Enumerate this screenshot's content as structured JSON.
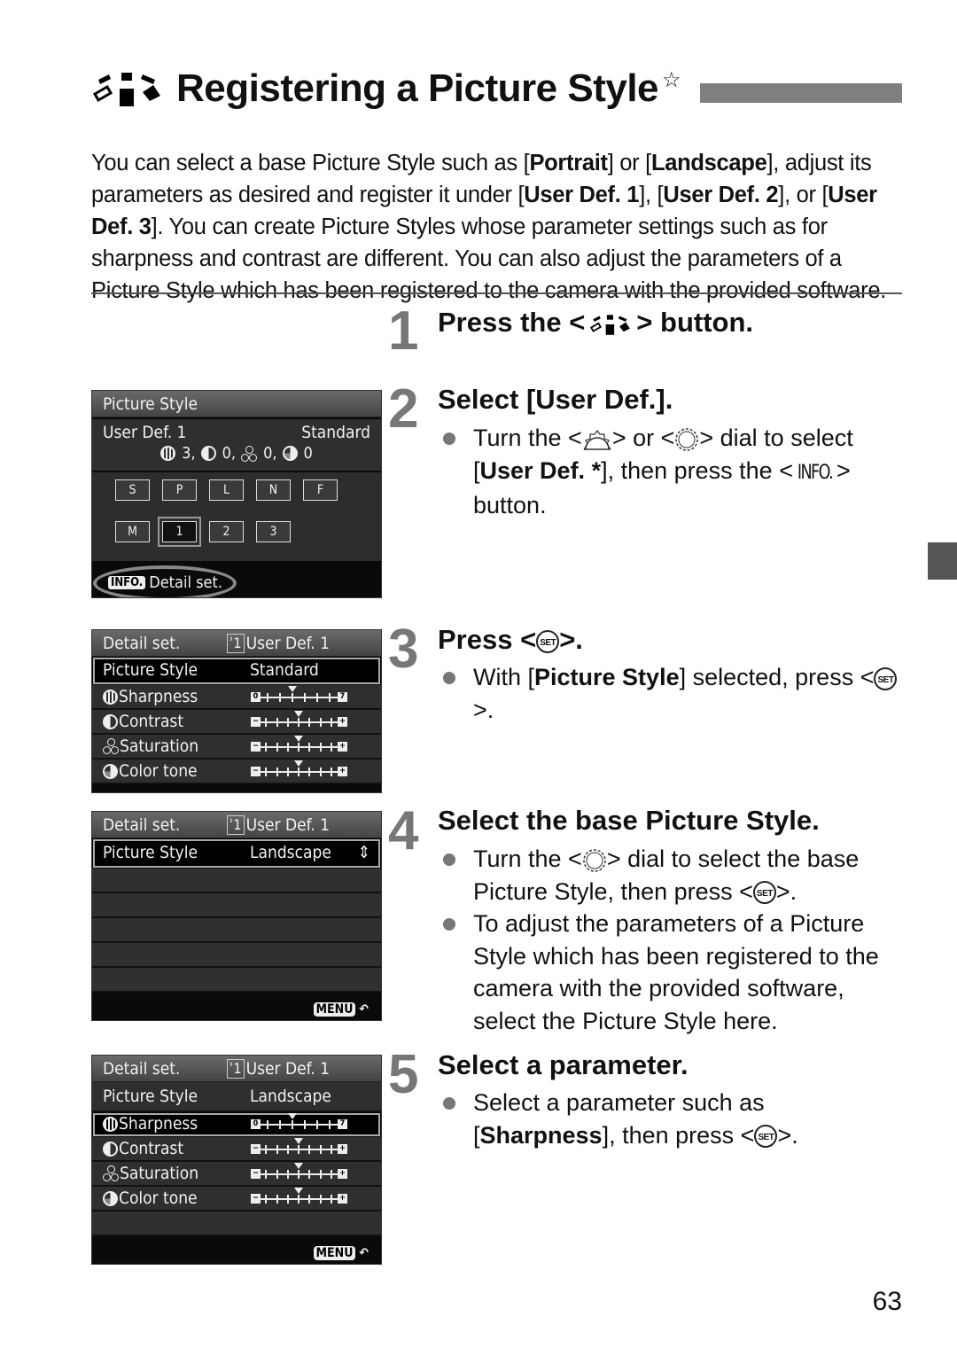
{
  "page": {
    "title": "Registering a Picture Style",
    "title_icon": "picture-style-icon",
    "title_star": "☆",
    "page_number": "63",
    "intro_html_parts": [
      {
        "t": "You can select a base Picture Style such as [",
        "b": false
      },
      {
        "t": "Portrait",
        "b": true
      },
      {
        "t": "] or [",
        "b": false
      },
      {
        "t": "Landscape",
        "b": true
      },
      {
        "t": "], adjust its parameters as desired and register it under [",
        "b": false
      },
      {
        "t": "User Def. 1",
        "b": true
      },
      {
        "t": "], [",
        "b": false
      },
      {
        "t": "User Def. 2",
        "b": true
      },
      {
        "t": "], or [",
        "b": false
      },
      {
        "t": "User Def. 3",
        "b": true
      },
      {
        "t": "]. You can create Picture Styles whose parameter settings such as for sharpness and contrast are different. You can also adjust the parameters of a Picture Style which has been registered to the camera with the provided software.",
        "b": false
      }
    ]
  },
  "steps": [
    {
      "num": "1",
      "title_pre": "Press the <",
      "title_post": "> button."
    },
    {
      "num": "2",
      "title": "Select [User Def.].",
      "bullets": [
        {
          "pre": "Turn the <",
          "mid1": "> or <",
          "mid2": "> dial to select [",
          "bold": "User Def. *",
          "post": "], then press the <",
          "info": "INFO.",
          "end": "> button."
        }
      ]
    },
    {
      "num": "3",
      "title_pre": "Press <",
      "title_post": ">.",
      "bullets": [
        {
          "pre": "With [",
          "bold": "Picture Style",
          "post": "] selected, press <",
          "end": ">."
        }
      ]
    },
    {
      "num": "4",
      "title": "Select the base Picture Style.",
      "bullets": [
        {
          "pre": "Turn the <",
          "post": "> dial to select the base Picture Style, then press <",
          "end": ">."
        },
        {
          "text": "To adjust the parameters of a Picture Style which has been registered to the camera with the provided software, select the Picture Style here."
        }
      ]
    },
    {
      "num": "5",
      "title": "Select a parameter.",
      "bullets": [
        {
          "pre": "Select a parameter such as [",
          "bold": "Sharpness",
          "post": "], then press <",
          "end": ">."
        }
      ]
    }
  ],
  "glyphs": {
    "set": "SET"
  },
  "screens": {
    "s1": {
      "header": "Picture Style",
      "user_def": "User Def. 1",
      "base": "Standard",
      "params": "3, 0, 0, 0",
      "params_list": [
        "3,",
        "0,",
        "0,",
        "0"
      ],
      "styles": [
        "S",
        "P",
        "L",
        "N",
        "F",
        "M",
        "1",
        "2",
        "3"
      ],
      "selected_style": "1",
      "info_key": "INFO.",
      "info_label": "Detail set."
    },
    "detail": {
      "header": "Detail set.",
      "user_def": "User Def. 1",
      "ps_label": "Picture Style",
      "params": [
        {
          "name": "Sharpness",
          "icon": "sharpness-icon",
          "value": 3,
          "min": 0,
          "max": 7
        },
        {
          "name": "Contrast",
          "icon": "contrast-icon",
          "value": 0,
          "min": -4,
          "max": 4
        },
        {
          "name": "Saturation",
          "icon": "saturation-icon",
          "value": 0,
          "min": -4,
          "max": 4
        },
        {
          "name": "Color tone",
          "icon": "color-tone-icon",
          "value": 0,
          "min": -4,
          "max": 4
        }
      ],
      "menu_key": "MENU",
      "back_glyph": "↶"
    },
    "s2": {
      "base": "Standard"
    },
    "s3": {
      "base": "Landscape",
      "updown": "⇕"
    },
    "s4": {
      "base": "Landscape"
    }
  }
}
